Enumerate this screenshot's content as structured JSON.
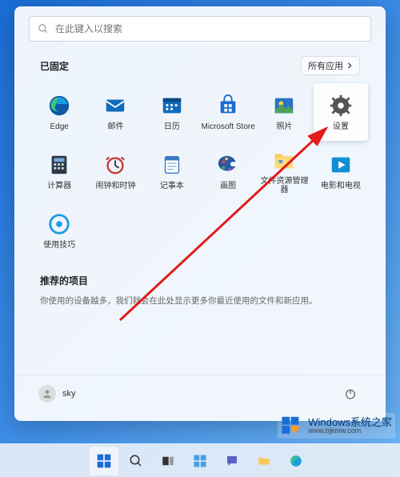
{
  "search": {
    "placeholder": "在此键入以搜索"
  },
  "pinned": {
    "title": "已固定",
    "all_apps_label": "所有应用",
    "apps": [
      {
        "id": "edge",
        "label": "Edge"
      },
      {
        "id": "mail",
        "label": "邮件"
      },
      {
        "id": "calendar",
        "label": "日历"
      },
      {
        "id": "msstore",
        "label": "Microsoft Store"
      },
      {
        "id": "photos",
        "label": "照片"
      },
      {
        "id": "settings",
        "label": "设置",
        "highlighted": true
      },
      {
        "id": "calculator",
        "label": "计算器"
      },
      {
        "id": "clock",
        "label": "闹钟和时钟"
      },
      {
        "id": "notepad",
        "label": "记事本"
      },
      {
        "id": "paint",
        "label": "画图"
      },
      {
        "id": "explorer",
        "label": "文件资源管理器"
      },
      {
        "id": "movies",
        "label": "电影和电视"
      },
      {
        "id": "tips",
        "label": "使用技巧"
      }
    ]
  },
  "recommended": {
    "title": "推荐的项目",
    "text": "你使用的设备越多，我们就会在此处显示更多你最近使用的文件和新应用。"
  },
  "user": {
    "name": "sky"
  },
  "watermark": {
    "top": "Windows系统之家",
    "bottom": "www.bjkmw.com"
  }
}
